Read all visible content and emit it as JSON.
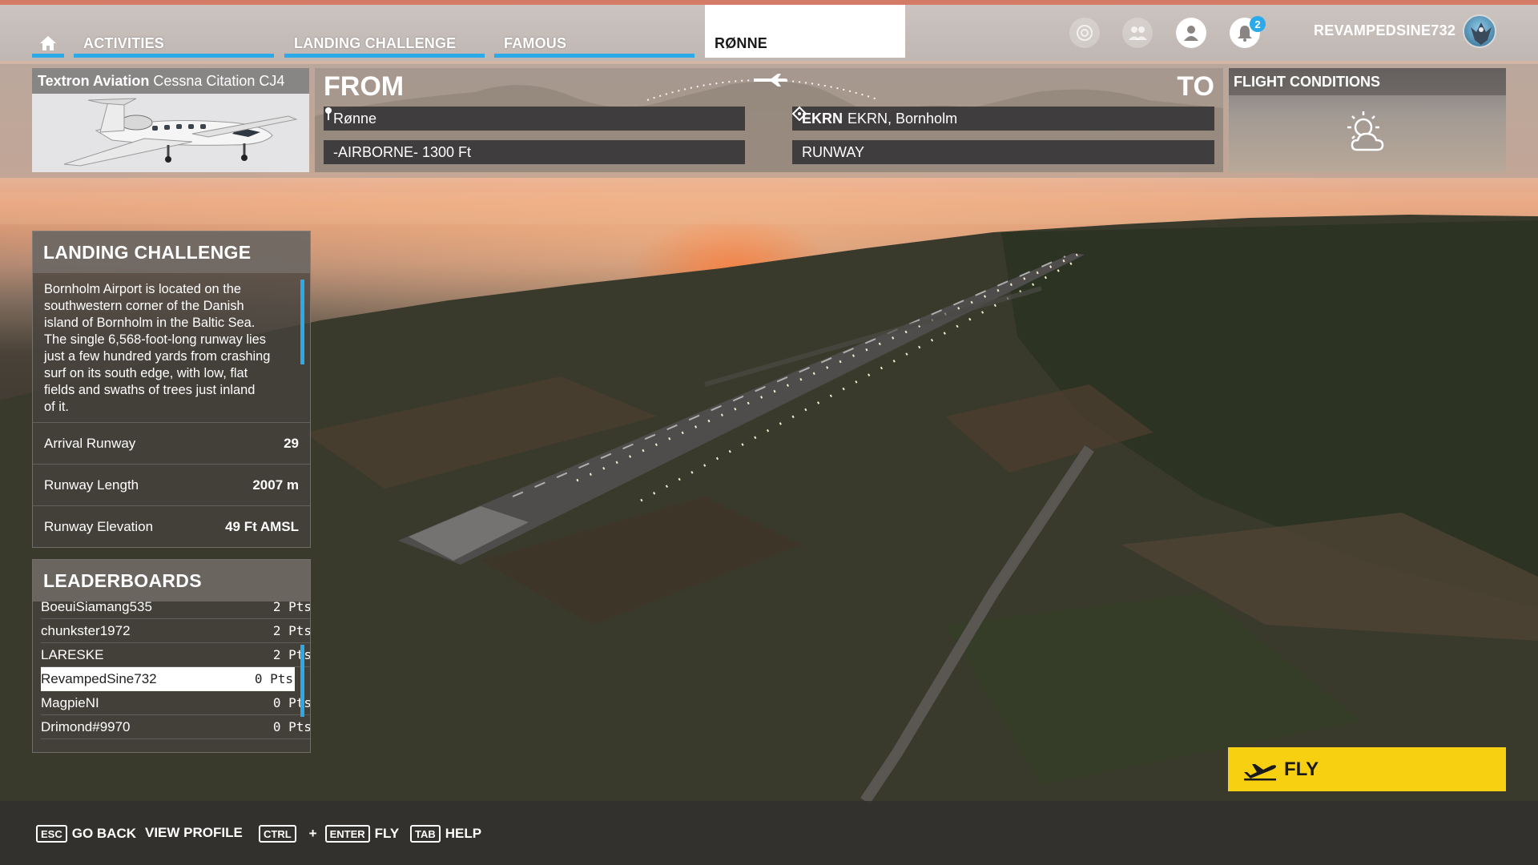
{
  "nav": {
    "tabs": [
      {
        "label": "ACTIVITIES"
      },
      {
        "label": "LANDING CHALLENGE"
      },
      {
        "label": "FAMOUS"
      },
      {
        "label": "RØNNE"
      }
    ],
    "notification_count": "2",
    "username": "REVAMPEDSINE732"
  },
  "aircraft": {
    "maker": "Textron Aviation",
    "model": "Cessna Citation CJ4"
  },
  "route": {
    "from_label": "FROM",
    "to_label": "TO",
    "from_place": "Rønne",
    "from_altitude": "-AIRBORNE- 1300 Ft",
    "to_code": "EKRN",
    "to_place": "EKRN, Bornholm",
    "to_runway": "RUNWAY"
  },
  "conditions": {
    "title": "FLIGHT CONDITIONS",
    "weather_icon": "partly-cloudy-icon"
  },
  "challenge": {
    "title": "LANDING CHALLENGE",
    "description_lines": [
      "Bornholm Airport is located on the",
      "southwestern corner of the Danish",
      "island of Bornholm in the Baltic Sea.",
      "The single 6,568-foot-long runway lies",
      "just a few hundred yards from crashing",
      "surf on its south edge, with low, flat",
      "fields and swaths of trees just inland",
      "of it."
    ],
    "stats": [
      {
        "label": "Arrival Runway",
        "value": "29"
      },
      {
        "label": "Runway Length",
        "value": "2007 m"
      },
      {
        "label": "Runway Elevation",
        "value": "49 Ft AMSL"
      }
    ]
  },
  "leaderboards": {
    "title": "LEADERBOARDS",
    "rows": [
      {
        "name": "BoeuiSiamang535",
        "pts": "2 Pts"
      },
      {
        "name": "chunkster1972",
        "pts": "2 Pts"
      },
      {
        "name": "LARESKE",
        "pts": "2 Pts"
      },
      {
        "name": "RevampedSine732",
        "pts": "0 Pts"
      },
      {
        "name": "MagpieNI",
        "pts": "0 Pts"
      },
      {
        "name": "Drimond#9970",
        "pts": "0 Pts"
      }
    ]
  },
  "fly_button": {
    "label": "FLY"
  },
  "footer": {
    "esc_key": "ESC",
    "go_back": "GO BACK",
    "view_profile": "VIEW PROFILE",
    "ctrl_key": "CTRL",
    "plus": "+",
    "enter_key": "ENTER",
    "fly": "FLY",
    "tab_key": "TAB",
    "help": "HELP"
  },
  "colors": {
    "accent_blue": "#2ca9e8",
    "fly_yellow": "#f8d012",
    "top_strip": "#d47b67"
  }
}
